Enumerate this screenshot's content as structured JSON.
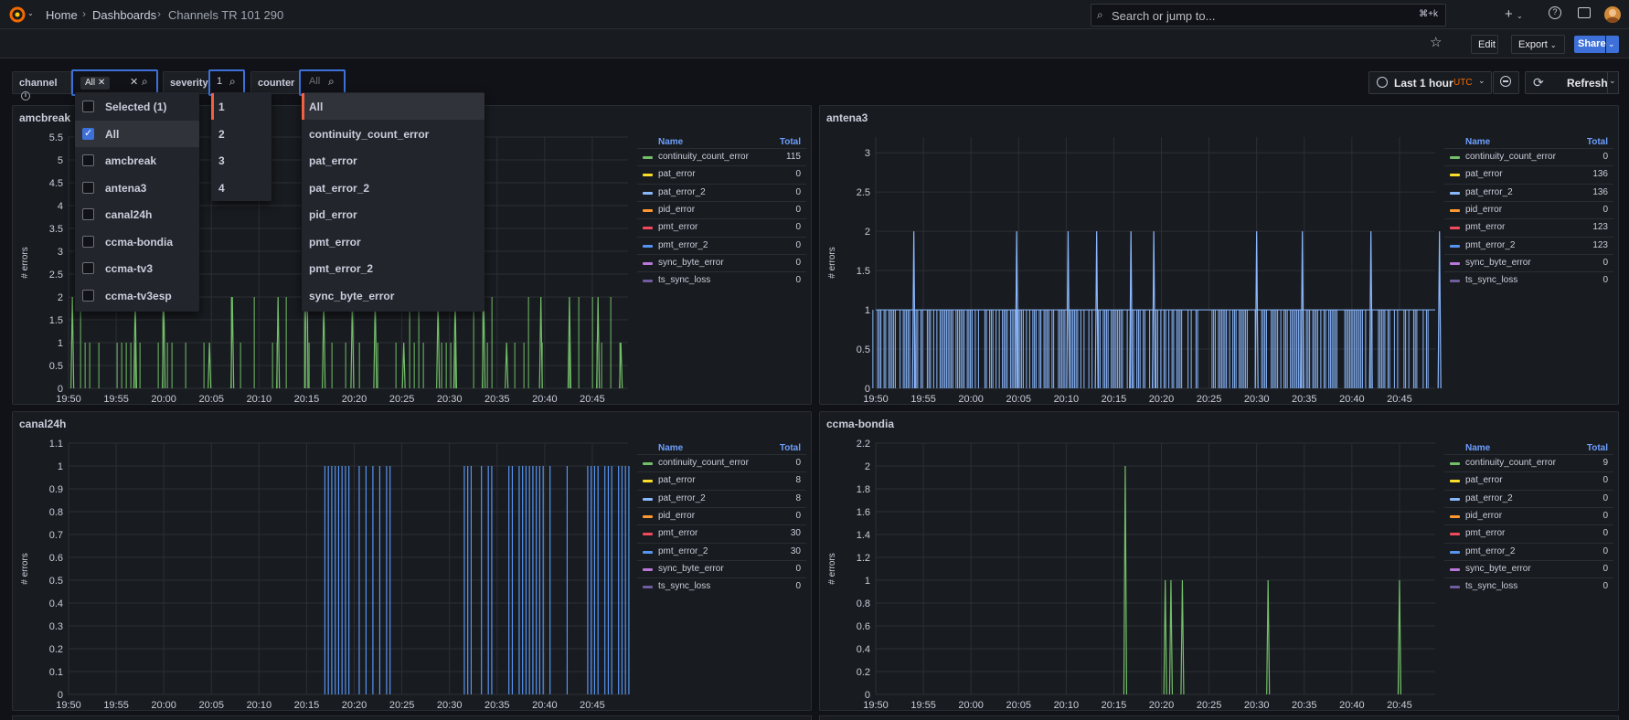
{
  "breadcrumbs": [
    "Home",
    "Dashboards",
    "Channels TR 101 290"
  ],
  "search": {
    "placeholder": "Search or jump to...",
    "shortcut": "⌘+k"
  },
  "toolbar": {
    "edit": "Edit",
    "export": "Export",
    "share": "Share"
  },
  "variables": {
    "channel": {
      "label": "channel",
      "chip": "All"
    },
    "severity": {
      "label": "severity",
      "value": "1"
    },
    "counter": {
      "label": "counter",
      "placeholder": "All"
    }
  },
  "dropdowns": {
    "channel": [
      "Selected (1)",
      "All",
      "amcbreak",
      "antena3",
      "canal24h",
      "ccma-bondia",
      "ccma-tv3",
      "ccma-tv3esp"
    ],
    "severity": [
      "1",
      "2",
      "3",
      "4"
    ],
    "counter": [
      "All",
      "continuity_count_error",
      "pat_error",
      "pat_error_2",
      "pid_error",
      "pmt_error",
      "pmt_error_2",
      "sync_byte_error"
    ]
  },
  "time": {
    "range": "Last 1 hour",
    "tz": "UTC",
    "refresh": "Refresh"
  },
  "colors": {
    "green": "#73bf69",
    "yellow": "#fade2a",
    "lightblue": "#8ab8ff",
    "orange": "#ff9830",
    "red": "#f2495c",
    "blue": "#5794f2",
    "purple": "#b877d9",
    "violet": "#705da0",
    "accent": "#3d71d9"
  },
  "legend": {
    "name": "Name",
    "total": "Total"
  },
  "series_names": [
    "continuity_count_error",
    "pat_error",
    "pat_error_2",
    "pid_error",
    "pmt_error",
    "pmt_error_2",
    "sync_byte_error",
    "ts_sync_loss"
  ],
  "chart_data": [
    {
      "type": "line",
      "title": "amcbreak",
      "ylabel": "# errors",
      "ylim": [
        0,
        5.5
      ],
      "yticks": [
        "0",
        "0.5",
        "1",
        "1.5",
        "2",
        "2.5",
        "3",
        "3.5",
        "4",
        "4.5",
        "5",
        "5.5"
      ],
      "x": [
        "19:50",
        "19:55",
        "20:00",
        "20:05",
        "20:10",
        "20:15",
        "20:20",
        "20:25",
        "20:30",
        "20:35",
        "20:40",
        "20:45"
      ],
      "totals": [
        "115",
        "0",
        "0",
        "0",
        "0",
        "0",
        "0",
        "0"
      ],
      "series": [
        {
          "name": "continuity_count_error",
          "peaks": [
            [
              19.51,
              2
            ],
            [
              19.62,
              1
            ],
            [
              19.73,
              1
            ],
            [
              19.84,
              2
            ],
            [
              19.95,
              2
            ],
            [
              20.0,
              2
            ],
            [
              20.08,
              1
            ],
            [
              20.12,
              2
            ],
            [
              20.2,
              2
            ],
            [
              20.25,
              5
            ],
            [
              20.28,
              2
            ],
            [
              20.33,
              2
            ],
            [
              20.37,
              2
            ],
            [
              20.42,
              1
            ],
            [
              20.48,
              2
            ],
            [
              20.51,
              2
            ],
            [
              20.56,
              2
            ],
            [
              20.6,
              1
            ],
            [
              20.66,
              2
            ],
            [
              20.71,
              2
            ],
            [
              20.76,
              2
            ],
            [
              20.8,
              1
            ]
          ]
        }
      ]
    },
    {
      "type": "line",
      "title": "antena3",
      "ylabel": "# errors",
      "ylim": [
        0,
        3.2
      ],
      "yticks": [
        "0",
        "0.5",
        "1",
        "1.5",
        "2",
        "2.5",
        "3"
      ],
      "x": [
        "19:50",
        "19:55",
        "20:00",
        "20:05",
        "20:10",
        "20:15",
        "20:20",
        "20:25",
        "20:30",
        "20:35",
        "20:40",
        "20:45"
      ],
      "totals": [
        "0",
        "136",
        "136",
        "0",
        "123",
        "123",
        "0",
        "0"
      ],
      "series": [
        {
          "name": "pat_error_2",
          "peaks": [
            [
              19.5,
              2
            ],
            [
              19.58,
              2
            ],
            [
              19.7,
              2
            ],
            [
              19.9,
              2
            ],
            [
              20.08,
              2
            ],
            [
              20.17,
              2
            ],
            [
              20.22,
              2
            ],
            [
              20.28,
              2
            ],
            [
              20.32,
              2
            ],
            [
              20.5,
              2
            ],
            [
              20.58,
              2
            ],
            [
              20.7,
              2
            ],
            [
              20.82,
              2
            ],
            [
              20.88,
              3
            ]
          ]
        }
      ]
    },
    {
      "type": "line",
      "title": "canal24h",
      "ylabel": "# errors",
      "ylim": [
        0,
        1.1
      ],
      "yticks": [
        "0",
        "0.1",
        "0.2",
        "0.3",
        "0.4",
        "0.5",
        "0.6",
        "0.7",
        "0.8",
        "0.9",
        "1",
        "1.1"
      ],
      "x": [
        "19:50",
        "19:55",
        "20:00",
        "20:05",
        "20:10",
        "20:15",
        "20:20",
        "20:25",
        "20:30",
        "20:35",
        "20:40",
        "20:45"
      ],
      "totals": [
        "0",
        "8",
        "8",
        "0",
        "30",
        "30",
        "0",
        "0"
      ],
      "series": [
        {
          "name": "pmt_error_2",
          "ranges": [
            [
              20.27,
              20.42
            ],
            [
              20.52,
              20.82
            ]
          ]
        }
      ]
    },
    {
      "type": "line",
      "title": "ccma-bondia",
      "ylabel": "# errors",
      "ylim": [
        0,
        2.2
      ],
      "yticks": [
        "0",
        "0.2",
        "0.4",
        "0.6",
        "0.8",
        "1",
        "1.2",
        "1.4",
        "1.6",
        "1.8",
        "2",
        "2.2"
      ],
      "x": [
        "19:50",
        "19:55",
        "20:00",
        "20:05",
        "20:10",
        "20:15",
        "20:20",
        "20:25",
        "20:30",
        "20:35",
        "20:40",
        "20:45"
      ],
      "totals": [
        "9",
        "0",
        "0",
        "0",
        "0",
        "0",
        "0",
        "0"
      ],
      "series": [
        {
          "name": "continuity_count_error",
          "peaks": [
            [
              20.27,
              2
            ],
            [
              20.34,
              1
            ],
            [
              20.35,
              1
            ],
            [
              20.37,
              1
            ],
            [
              20.52,
              1
            ],
            [
              20.75,
              1
            ]
          ]
        }
      ]
    }
  ]
}
